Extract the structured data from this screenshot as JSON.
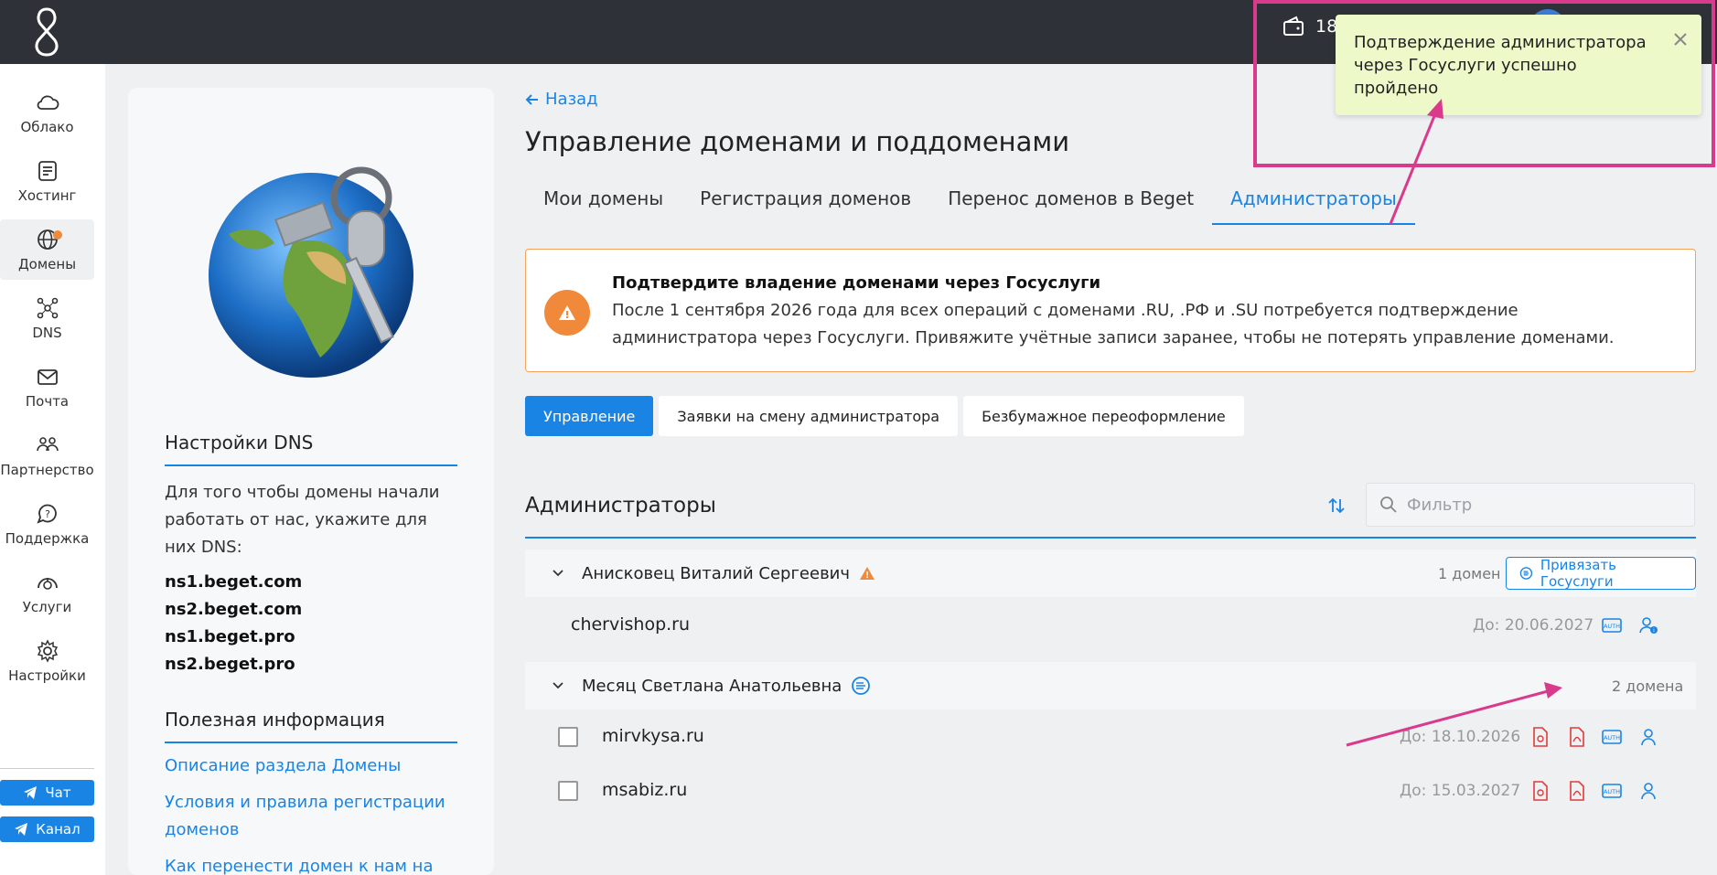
{
  "header": {
    "balance": "18"
  },
  "sidebar": {
    "items": [
      {
        "label": "Облако",
        "icon": "cloud-icon"
      },
      {
        "label": "Хостинг",
        "icon": "hosting-icon"
      },
      {
        "label": "Домены",
        "icon": "globe-icon"
      },
      {
        "label": "DNS",
        "icon": "dns-icon"
      },
      {
        "label": "Почта",
        "icon": "mail-icon"
      },
      {
        "label": "Партнерство",
        "icon": "partners-icon"
      },
      {
        "label": "Поддержка",
        "icon": "support-icon"
      },
      {
        "label": "Услуги",
        "icon": "services-icon"
      },
      {
        "label": "Настройки",
        "icon": "gear-icon"
      }
    ],
    "chat_label": "Чат",
    "channel_label": "Канал"
  },
  "info_panel": {
    "dns_heading": "Настройки DNS",
    "dns_text": "Для того чтобы домены начали работать от нас, укажите для них DNS:",
    "ns": [
      "ns1.beget.com",
      "ns2.beget.com",
      "ns1.beget.pro",
      "ns2.beget.pro"
    ],
    "useful_heading": "Полезная информация",
    "links": [
      "Описание раздела Домены",
      "Условия и правила регистрации доменов",
      "Как перенести домен к нам на"
    ]
  },
  "main": {
    "back_label": "Назад",
    "title": "Управление доменами и поддоменами",
    "tabs": [
      "Мои домены",
      "Регистрация доменов",
      "Перенос доменов в Beget",
      "Администраторы"
    ],
    "alert": {
      "title": "Подтвердите владение доменами через Госуслуги",
      "text": "После 1 сентября 2026 года для всех операций с доменами .RU, .РФ и .SU потребуется подтверждение администратора через Госуслуги. Привяжите учётные записи заранее, чтобы не потерять управление доменами."
    },
    "pills": [
      "Управление",
      "Заявки на смену администратора",
      "Безбумажное переоформление"
    ],
    "section_title": "Администраторы",
    "filter_placeholder": "Фильтр",
    "groups": [
      {
        "name": "Анисковец Виталий Сергеевич",
        "count": "1 домен",
        "button": "Привязать Госуслуги",
        "domains": [
          {
            "name": "chervishop.ru",
            "date": "До: 20.06.2027"
          }
        ]
      },
      {
        "name": "Месяц Светлана Анатольевна",
        "count": "2 домена",
        "domains": [
          {
            "name": "mirvkysa.ru",
            "date": "До: 18.10.2026"
          },
          {
            "name": "msabiz.ru",
            "date": "До: 15.03.2027"
          }
        ]
      }
    ]
  },
  "toast": {
    "text": "Подтверждение администратора через Госуслуги успешно пройдено"
  },
  "colors": {
    "accent": "#1a84e5",
    "warning": "#f08a3a",
    "highlight": "#d93a8c",
    "toast_bg": "#eef9c9"
  }
}
